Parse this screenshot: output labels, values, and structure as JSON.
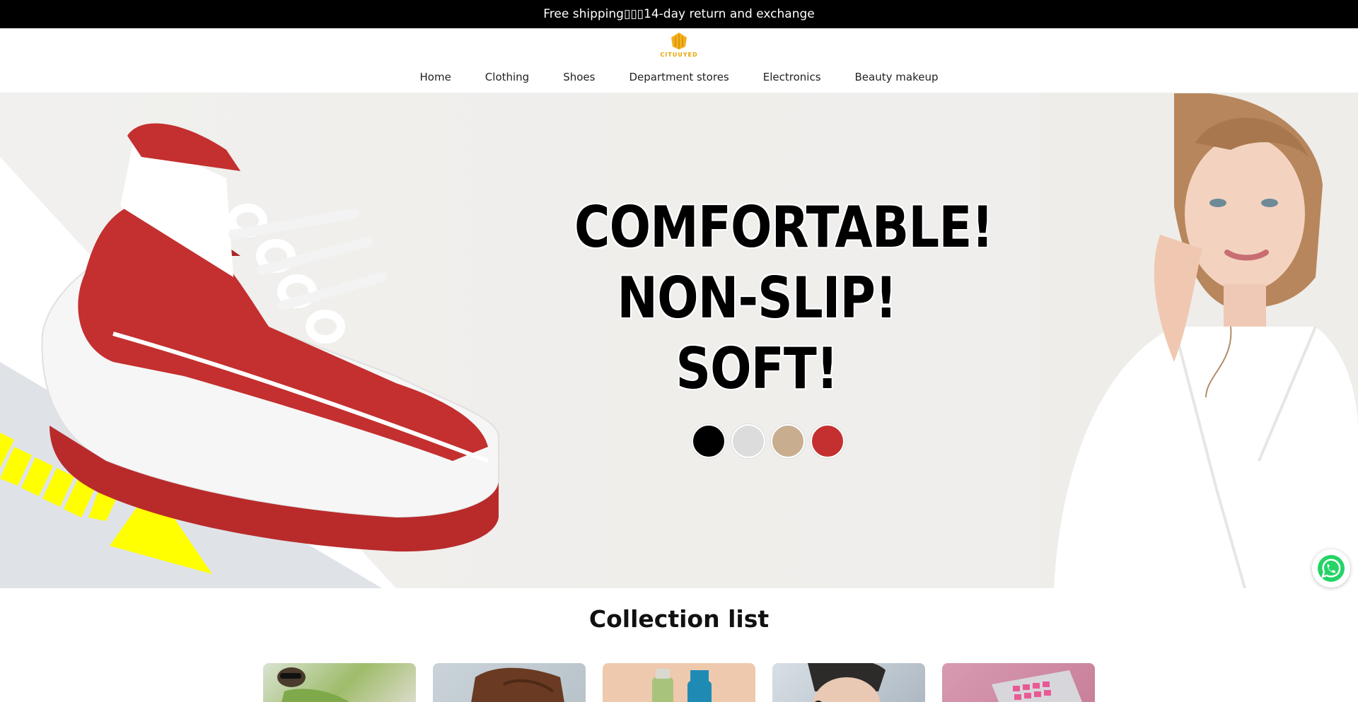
{
  "announcement": "Free shipping\u0000\u0000\u000014-day return and exchange",
  "brand": {
    "name": "CITUUYED",
    "color": "#e8a400"
  },
  "nav": {
    "items": [
      "Home",
      "Clothing",
      "Shoes",
      "Department stores",
      "Electronics",
      "Beauty makeup"
    ]
  },
  "hero": {
    "lines": [
      "COMFORTABLE!",
      "NON-SLIP!",
      "SOFT!"
    ],
    "swatches": [
      "#000000",
      "#dcdcdc",
      "#c8ad8f",
      "#c42f2f"
    ]
  },
  "collection": {
    "title": "Collection list",
    "cards": [
      "fashion",
      "boots",
      "cleaning",
      "headphones",
      "makeup"
    ]
  },
  "whatsapp": {
    "icon": "whatsapp-icon",
    "color": "#25d366"
  }
}
